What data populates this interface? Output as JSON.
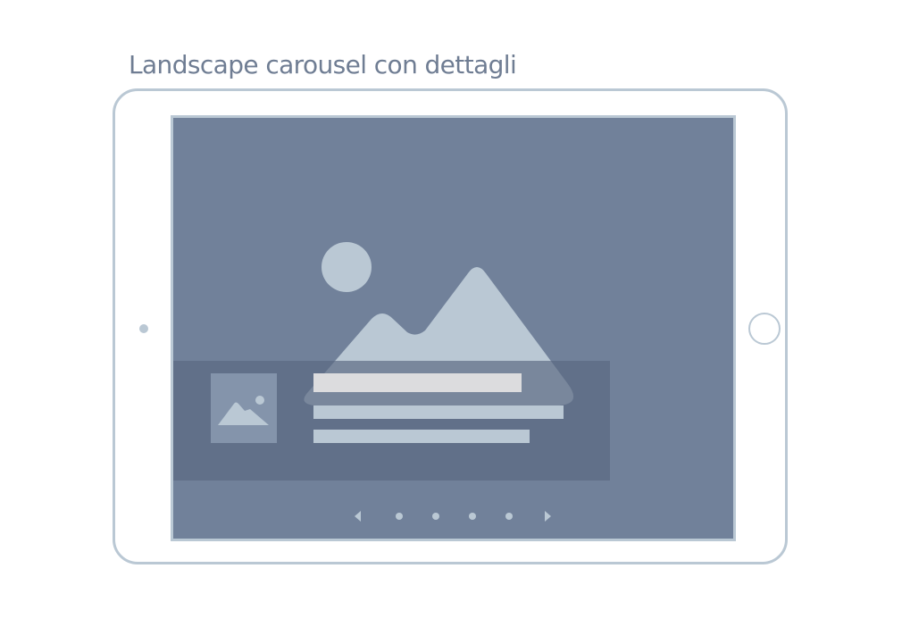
{
  "header": {
    "title": "Landscape carousel con dettagli"
  },
  "colors": {
    "tablet_frame": "#bac8d4",
    "screen_background": "#71819a",
    "detail_panel": "#5a6982",
    "title_bar": "#dcdcde",
    "text_lines": "#bac8d4",
    "title_text": "#6f7d93"
  },
  "icons": {
    "hero": "landscape-image-placeholder-icon",
    "thumbnail": "image-thumbnail-icon",
    "prev": "chevron-left-icon",
    "next": "chevron-right-icon"
  },
  "carousel": {
    "page_count": 4
  }
}
